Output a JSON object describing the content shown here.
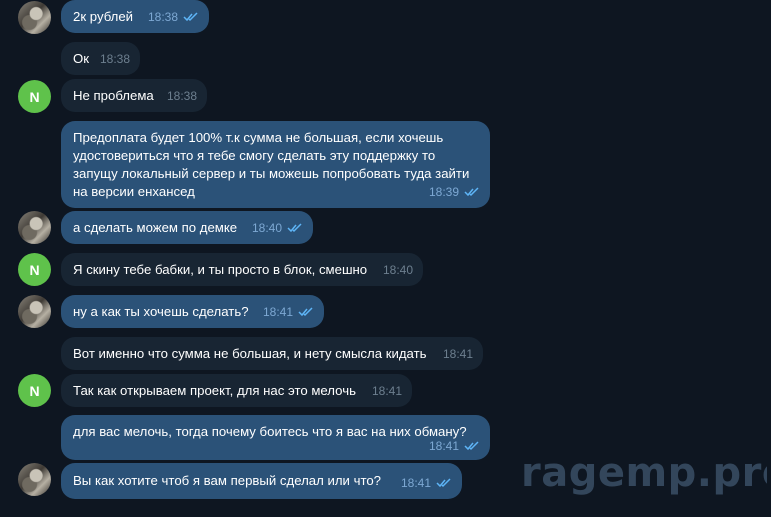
{
  "messages": [
    {
      "text": "2к рублей",
      "time": "18:38",
      "read": true
    },
    {
      "text": "Ок",
      "time": "18:38"
    },
    {
      "text": "Не проблема",
      "time": "18:38",
      "avatar_letter": "N"
    },
    {
      "text": "Предоплата будет 100% т.к сумма не большая, если хочешь удостовериться что я тебе смогу сделать эту поддержку то запущу локальный сервер и ты можешь попробовать туда зайти на версии енхансед",
      "time": "18:39",
      "read": true
    },
    {
      "text": "а сделать можем по демке",
      "time": "18:40",
      "read": true
    },
    {
      "text": "Я скину тебе бабки, и ты просто в блок, смешно",
      "time": "18:40",
      "avatar_letter": "N"
    },
    {
      "text": "ну а как ты хочешь сделать?",
      "time": "18:41",
      "read": true
    },
    {
      "text": "Вот именно что сумма не большая, и нету смысла кидать",
      "time": "18:41"
    },
    {
      "text": "Так как открываем проект, для нас это мелочь",
      "time": "18:41",
      "avatar_letter": "N"
    },
    {
      "text": "для вас мелочь, тогда почему боитесь что я вас на них обману?",
      "time": "18:41",
      "read": true
    },
    {
      "text": "Вы как хотите чтоб я вам первый сделал или что?",
      "time": "18:41",
      "read": true
    }
  ],
  "watermark": "ragemp.pro",
  "colors": {
    "background": "#0e1621",
    "incoming": "#182533",
    "outgoing": "#2b5278",
    "avatar_n": "#5fc24b",
    "read_ticks": "#5eb5f7"
  }
}
